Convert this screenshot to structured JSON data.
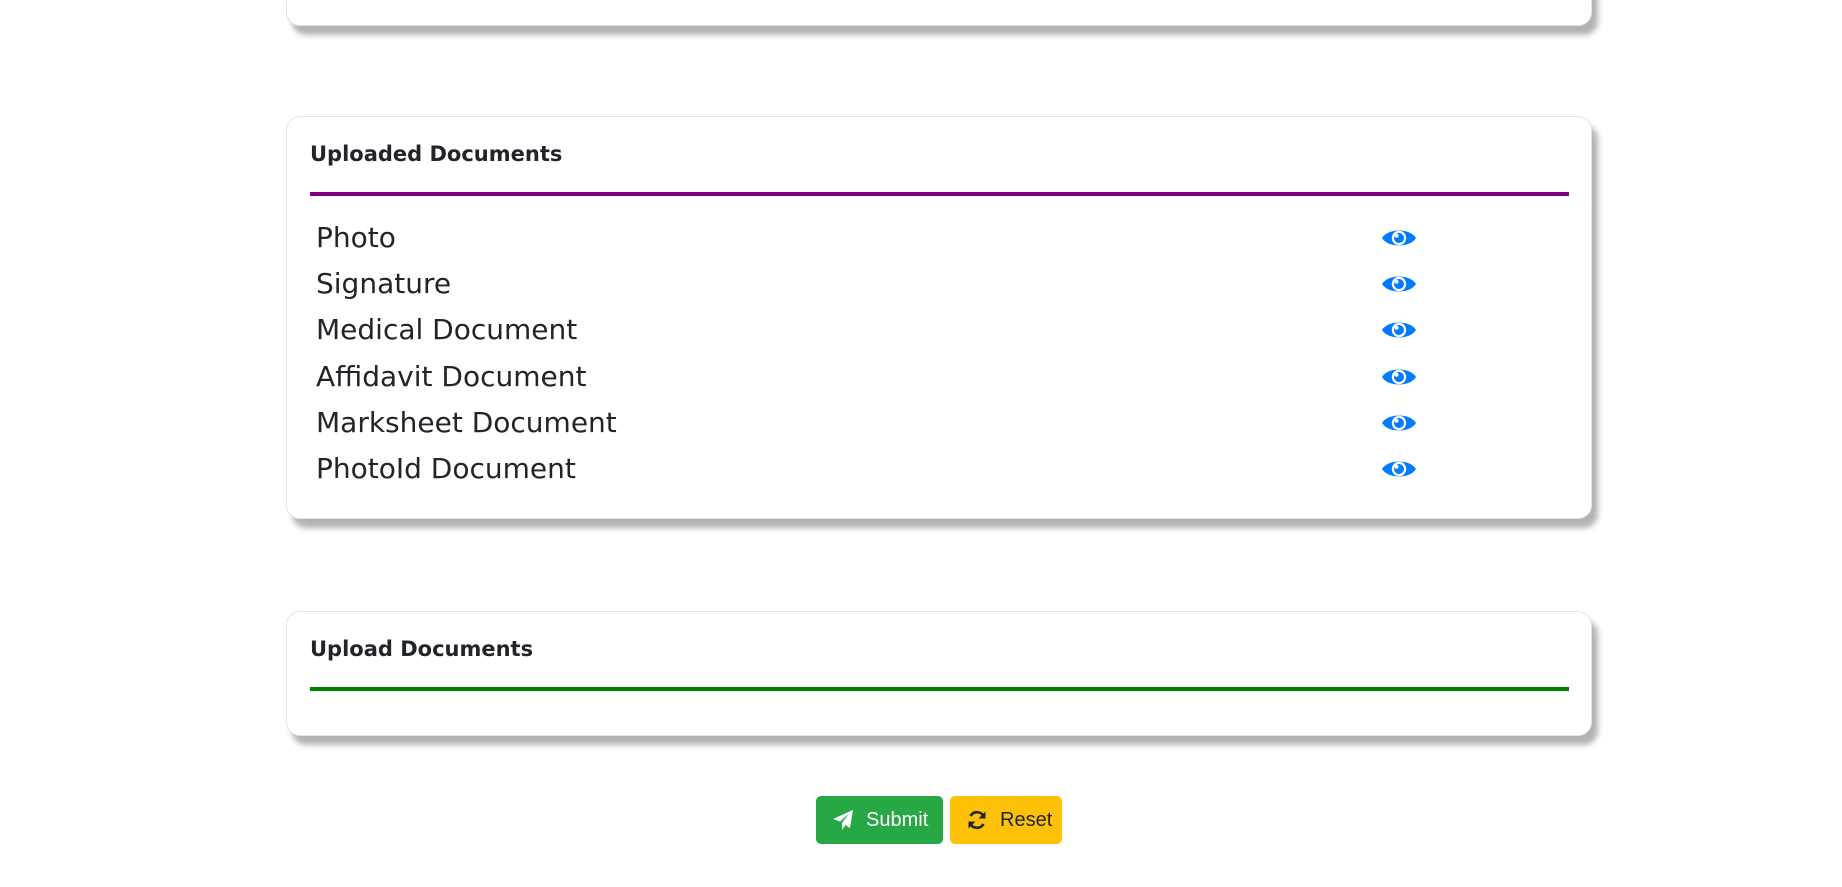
{
  "uploaded_section": {
    "title": "Uploaded Documents",
    "documents": [
      {
        "label": "Photo",
        "icon": "eye-icon"
      },
      {
        "label": "Signature",
        "icon": "eye-icon"
      },
      {
        "label": "Medical Document",
        "icon": "eye-icon"
      },
      {
        "label": "Affidavit Document",
        "icon": "eye-icon"
      },
      {
        "label": "Marksheet Document",
        "icon": "eye-icon"
      },
      {
        "label": "PhotoId Document",
        "icon": "eye-icon"
      }
    ]
  },
  "upload_section": {
    "title": "Upload Documents"
  },
  "actions": {
    "submit_label": "Submit",
    "submit_icon": "paper-plane-icon",
    "reset_label": "Reset",
    "reset_icon": "refresh-icon"
  },
  "colors": {
    "uploaded_divider": "#800080",
    "upload_divider": "#008000",
    "eye_icon": "#007bff",
    "submit_button": "#28a745",
    "reset_button": "#ffc107"
  }
}
